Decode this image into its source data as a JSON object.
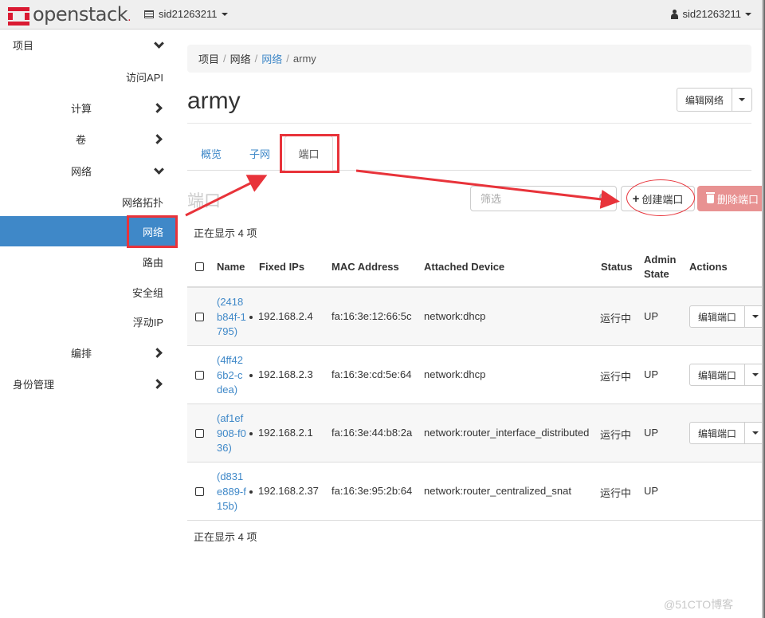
{
  "navbar": {
    "brand": "openstack",
    "project": "sid21263211",
    "user": "sid21263211",
    "brand_color": "#da1a32"
  },
  "sidebar": {
    "items": [
      {
        "label": "项目",
        "level": 0,
        "chevron": "down"
      },
      {
        "label": "访问API",
        "level": 2
      },
      {
        "label": "计算",
        "level": 1,
        "chevron": "right"
      },
      {
        "label": "卷",
        "level": 1,
        "chevron": "right"
      },
      {
        "label": "网络",
        "level": 1,
        "chevron": "down"
      },
      {
        "label": "网络拓扑",
        "level": 2
      },
      {
        "label": "网络",
        "level": 2,
        "active": true
      },
      {
        "label": "路由",
        "level": 2
      },
      {
        "label": "安全组",
        "level": 2
      },
      {
        "label": "浮动IP",
        "level": 2
      },
      {
        "label": "编排",
        "level": 1,
        "chevron": "right"
      },
      {
        "label": "身份管理",
        "level": 0,
        "chevron": "right"
      }
    ],
    "active_color": "#3f88c8"
  },
  "breadcrumb": [
    "项目",
    "网络",
    "网络",
    "army"
  ],
  "page": {
    "title": "army",
    "edit_network_label": "编辑网络"
  },
  "tabs": [
    {
      "label": "概览",
      "active": false
    },
    {
      "label": "子网",
      "active": false
    },
    {
      "label": "端口",
      "active": true
    }
  ],
  "ports": {
    "section_title": "端口",
    "filter_placeholder": "筛选",
    "create_label": "创建端口",
    "delete_label": "删除端口",
    "count_top": "正在显示 4 项",
    "count_bottom": "正在显示 4 项",
    "columns": [
      "Name",
      "Fixed IPs",
      "MAC Address",
      "Attached Device",
      "Status",
      "Admin State",
      "Actions"
    ],
    "admin_state_line1": "Admin",
    "admin_state_line2": "State",
    "edit_port_label": "编辑端口",
    "rows": [
      {
        "name_lines": [
          "(2418",
          "b84f-1",
          "795)"
        ],
        "ip": "192.168.2.4",
        "mac": "fa:16:3e:12:66:5c",
        "device": "network:dhcp",
        "status": "运行中",
        "admin": "UP",
        "has_action": true
      },
      {
        "name_lines": [
          "(4ff42",
          "6b2-c",
          "dea)"
        ],
        "ip": "192.168.2.3",
        "mac": "fa:16:3e:cd:5e:64",
        "device": "network:dhcp",
        "status": "运行中",
        "admin": "UP",
        "has_action": true
      },
      {
        "name_lines": [
          "(af1ef",
          "908-f0",
          "36)"
        ],
        "ip": "192.168.2.1",
        "mac": "fa:16:3e:44:b8:2a",
        "device": "network:router_interface_distributed",
        "status": "运行中",
        "admin": "UP",
        "has_action": true
      },
      {
        "name_lines": [
          "(d831",
          "e889-f",
          "15b)"
        ],
        "ip": "192.168.2.37",
        "mac": "fa:16:3e:95:2b:64",
        "device": "network:router_centralized_snat",
        "status": "运行中",
        "admin": "UP",
        "has_action": false
      }
    ]
  },
  "annotation_color": "#e8333a",
  "watermark": "@51CTO博客"
}
